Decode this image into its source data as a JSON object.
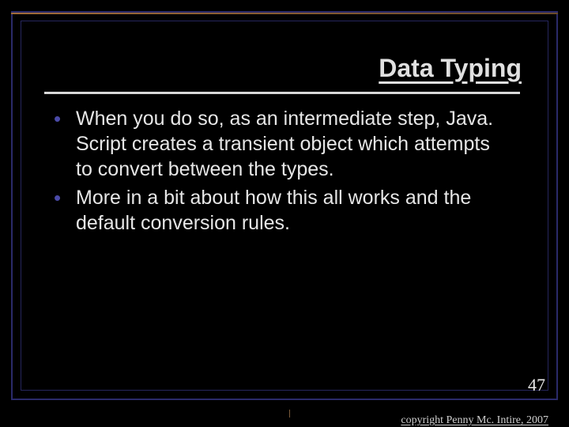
{
  "title": "Data Typing",
  "bullets": [
    "When you do so, as an intermediate step, Java. Script creates a transient object which attempts to convert between the types.",
    "More in a bit about how this all works and the default conversion rules."
  ],
  "page_number": "47",
  "copyright": "copyright Penny Mc. Intire, 2007"
}
